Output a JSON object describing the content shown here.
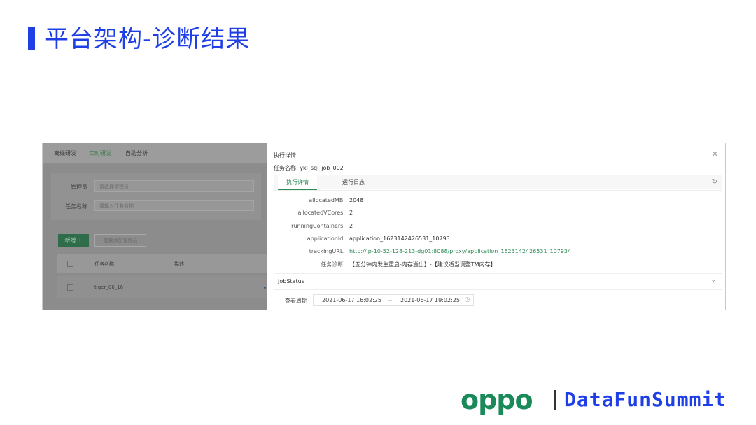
{
  "slide": {
    "title": "平台架构-诊断结果"
  },
  "bg": {
    "tabs": [
      "离线研发",
      "实时研发",
      "自助分析"
    ],
    "filter": {
      "admin_label": "管理员",
      "admin_placeholder": "请选择管理员",
      "task_label": "任务名称",
      "task_placeholder": "请输入任务名称"
    },
    "buttons": {
      "new": "新增 +",
      "batch": "批量添加管理员"
    },
    "table": {
      "headers": [
        "任务名称",
        "描述"
      ],
      "rows": [
        {
          "name": "tiger_06_16"
        }
      ]
    }
  },
  "drawer": {
    "title": "执行详情",
    "task_label": "任务名称: ykl_sql_job_002",
    "tabs": [
      "执行详情",
      "运行日志"
    ],
    "details": [
      {
        "key": "allocatedMB:",
        "value": "2048"
      },
      {
        "key": "allocatedVCores:",
        "value": "2"
      },
      {
        "key": "runningContainers:",
        "value": "2"
      },
      {
        "key": "applicationId:",
        "value": "application_1623142426531_10793"
      },
      {
        "key": "trackingURL:",
        "value": "http://ip-10-52-128-213-dg01:8088/proxy/application_1623142426531_10793/"
      },
      {
        "key": "任务诊断:",
        "value": "【五分钟内发生重启-内存溢出】-【建议适当调整TM内存】"
      }
    ],
    "job_status": "JobStatus",
    "period_label": "查看周期",
    "range_start": "2021-06-17 16:02:25",
    "range_sep": "~",
    "range_end": "2021-06-17 19:02:25"
  },
  "footer": {
    "brand1": "oppo",
    "brand2": "DataFunSummit"
  },
  "colors": {
    "accent": "#1f3fe6",
    "green": "#2e8a57",
    "oppo": "#1a8a5a"
  }
}
